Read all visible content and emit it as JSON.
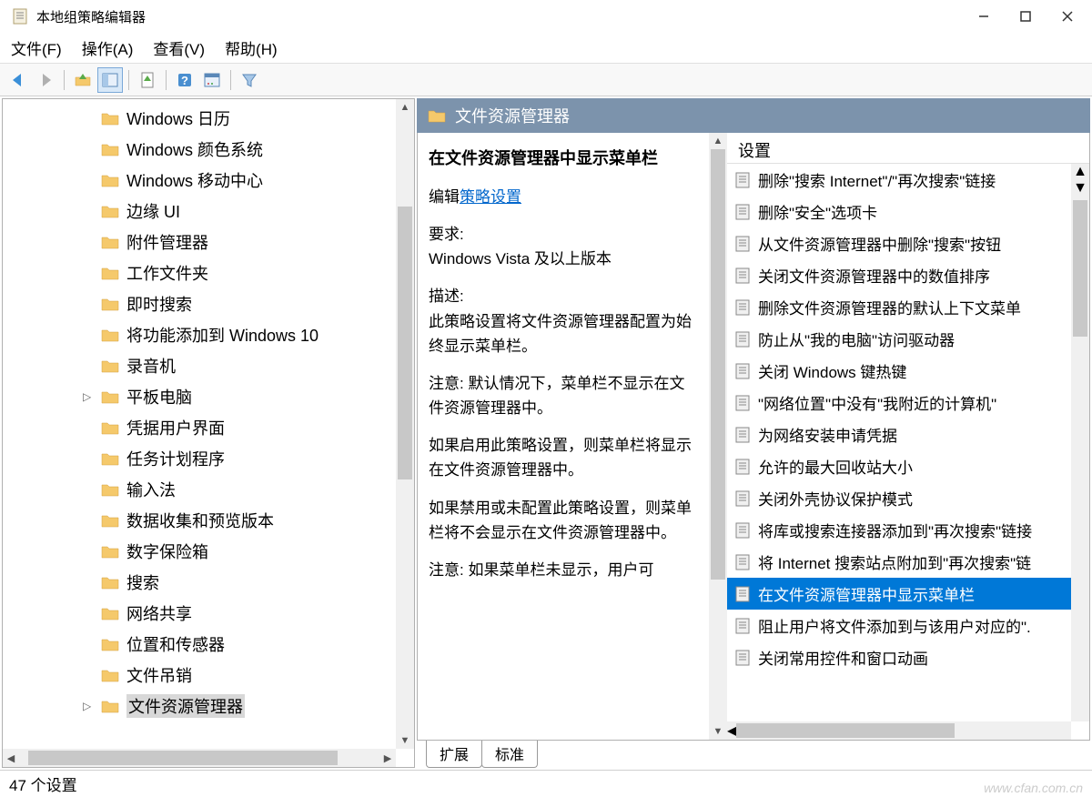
{
  "window": {
    "title": "本地组策略编辑器"
  },
  "menubar": {
    "file": "文件(F)",
    "action": "操作(A)",
    "view": "查看(V)",
    "help": "帮助(H)"
  },
  "tree": {
    "items": [
      {
        "label": "Windows 日历",
        "expand": ""
      },
      {
        "label": "Windows 颜色系统",
        "expand": ""
      },
      {
        "label": "Windows 移动中心",
        "expand": ""
      },
      {
        "label": "边缘 UI",
        "expand": ""
      },
      {
        "label": "附件管理器",
        "expand": ""
      },
      {
        "label": "工作文件夹",
        "expand": ""
      },
      {
        "label": "即时搜索",
        "expand": ""
      },
      {
        "label": "将功能添加到 Windows 10",
        "expand": ""
      },
      {
        "label": "录音机",
        "expand": ""
      },
      {
        "label": "平板电脑",
        "expand": "▷"
      },
      {
        "label": "凭据用户界面",
        "expand": ""
      },
      {
        "label": "任务计划程序",
        "expand": ""
      },
      {
        "label": "输入法",
        "expand": ""
      },
      {
        "label": "数据收集和预览版本",
        "expand": ""
      },
      {
        "label": "数字保险箱",
        "expand": ""
      },
      {
        "label": "搜索",
        "expand": ""
      },
      {
        "label": "网络共享",
        "expand": ""
      },
      {
        "label": "位置和传感器",
        "expand": ""
      },
      {
        "label": "文件吊销",
        "expand": ""
      },
      {
        "label": "文件资源管理器",
        "expand": "▷",
        "selected": true
      }
    ]
  },
  "rightHeader": {
    "title": "文件资源管理器"
  },
  "detail": {
    "title": "在文件资源管理器中显示菜单栏",
    "editLabel": "编辑",
    "editLink": "策略设置",
    "reqLabel": "要求:",
    "reqText": "Windows Vista 及以上版本",
    "descLabel": "描述:",
    "descText": "此策略设置将文件资源管理器配置为始终显示菜单栏。",
    "note1": "注意: 默认情况下，菜单栏不显示在文件资源管理器中。",
    "enableText": "如果启用此策略设置，则菜单栏将显示在文件资源管理器中。",
    "disableText": "如果禁用或未配置此策略设置，则菜单栏将不会显示在文件资源管理器中。",
    "note2": "注意: 如果菜单栏未显示，用户可"
  },
  "settings": {
    "header": "设置",
    "items": [
      "删除\"搜索 Internet\"/\"再次搜索\"链接",
      "删除\"安全\"选项卡",
      "从文件资源管理器中删除\"搜索\"按钮",
      "关闭文件资源管理器中的数值排序",
      "删除文件资源管理器的默认上下文菜单",
      "防止从\"我的电脑\"访问驱动器",
      "关闭 Windows 键热键",
      "\"网络位置\"中没有\"我附近的计算机\"",
      "为网络安装申请凭据",
      "允许的最大回收站大小",
      "关闭外壳协议保护模式",
      "将库或搜索连接器添加到\"再次搜索\"链接",
      "将 Internet 搜索站点附加到\"再次搜索\"链",
      "在文件资源管理器中显示菜单栏",
      "阻止用户将文件添加到与该用户对应的\".",
      "关闭常用控件和窗口动画"
    ],
    "selectedIndex": 13
  },
  "tabs": {
    "extended": "扩展",
    "standard": "标准"
  },
  "statusbar": {
    "text": "47 个设置",
    "watermark": "www.cfan.com.cn"
  }
}
